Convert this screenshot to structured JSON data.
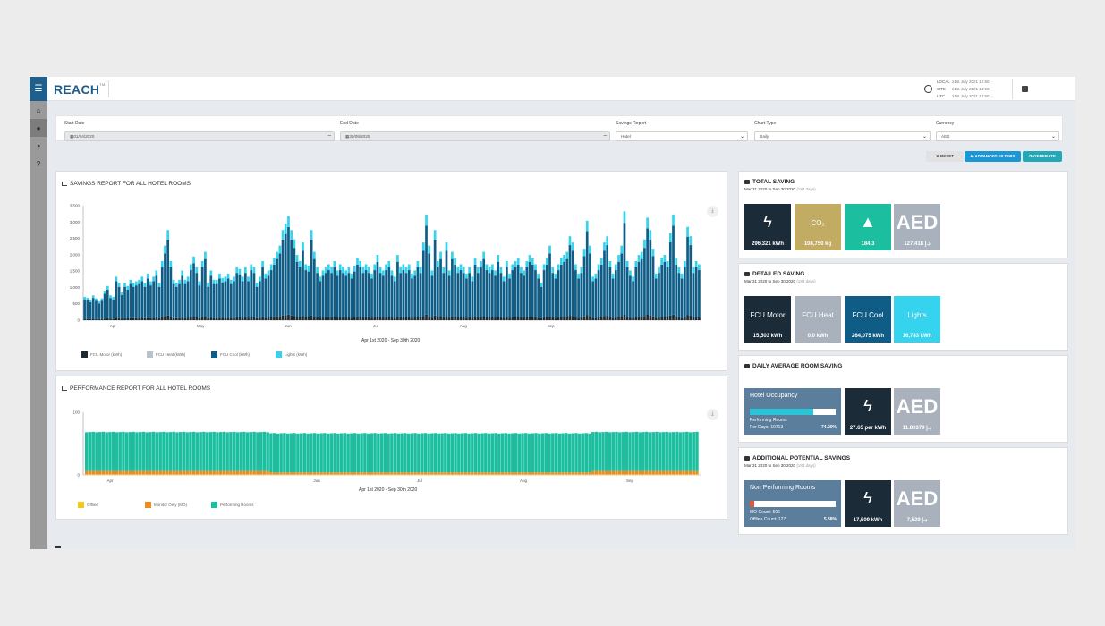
{
  "app": {
    "logo": "REACH",
    "logo_tm": "TM"
  },
  "header": {
    "times": [
      {
        "label": "LOCAL",
        "value": "21st July 2021 12:50"
      },
      {
        "label": "SITE",
        "value": "21st July 2021 14:50"
      },
      {
        "label": "UTC",
        "value": "21st July 2021 10:50"
      }
    ]
  },
  "filters": {
    "start_date": {
      "label": "Start Date",
      "value": "01/04/2020"
    },
    "end_date": {
      "label": "End Date",
      "value": "30/09/2020"
    },
    "savings_report": {
      "label": "Savings Report",
      "value": "Hotel"
    },
    "chart_type": {
      "label": "Chart Type",
      "value": "Daily"
    },
    "currency": {
      "label": "Currency",
      "value": "AED"
    }
  },
  "buttons": {
    "reset": "✕ RESET",
    "advanced": "⇋ ADVANCED FILTERS",
    "generate": "⟳ GENERATE"
  },
  "savings_panel": {
    "title": "SAVINGS REPORT FOR ALL HOTEL ROOMS",
    "caption": "Apr 1st 2020 - Sep 30th 2020",
    "legend": [
      {
        "label": "FCU Motor (kWh)",
        "color": "#1b2a33"
      },
      {
        "label": "FCU Heat (kWh)",
        "color": "#b7c2cc"
      },
      {
        "label": "FCU Cool (kWh)",
        "color": "#0f5d86"
      },
      {
        "label": "Lights (kWh)",
        "color": "#36d3ef"
      }
    ]
  },
  "performance_panel": {
    "title": "PERFORMANCE REPORT FOR ALL HOTEL ROOMS",
    "caption": "Apr 1st 2020 - Sep 30th 2020",
    "legend": [
      {
        "label": "Offline",
        "color": "#f5c518"
      },
      {
        "label": "Monitor Only (MO)",
        "color": "#f08a1c"
      },
      {
        "label": "Performing Rooms",
        "color": "#1bbf9f"
      }
    ]
  },
  "total_saving": {
    "title": "TOTAL SAVING",
    "range": "Mar 31 2020 to Sep 30 2020",
    "days": "(183 days)",
    "tiles": [
      {
        "value": "296,321 kWh",
        "color": "#1b2b38"
      },
      {
        "value": "108,750 kg",
        "badge": "CO₂",
        "color": "#c2ab62"
      },
      {
        "value": "184.3",
        "color": "#1bbf9f"
      },
      {
        "big": "AED",
        "value": "127,418 د.إ",
        "color": "#a9b2bc"
      }
    ]
  },
  "detailed_saving": {
    "title": "DETAILED SAVING",
    "range": "Mar 31 2020 to Sep 30 2020",
    "days": "(183 days)",
    "tiles": [
      {
        "name": "FCU Motor",
        "value": "15,503 kWh",
        "color": "#1b2b38"
      },
      {
        "name": "FCU Heat",
        "value": "0.0 kWh",
        "color": "#a9b2bc"
      },
      {
        "name": "FCU Cool",
        "value": "264,075 kWh",
        "color": "#0f5d86"
      },
      {
        "name": "Lights",
        "value": "16,743 kWh",
        "color": "#36d3ef"
      }
    ]
  },
  "daily_average": {
    "title": "DAILY AVERAGE ROOM SAVING",
    "occupancy": {
      "title": "Hotel Occupancy",
      "l1": "Performing Rooms",
      "l2": "Per Days: 10713",
      "pct": "74.20%",
      "fill": 0.742
    },
    "energy": "27.65 per kWh",
    "currency": {
      "big": "AED",
      "value": "11.89379 د.إ"
    }
  },
  "additional": {
    "title": "ADDITIONAL POTENTIAL SAVINGS",
    "range": "Mar 31 2020 to Sep 30 2020",
    "days": "(183 days)",
    "non_perf": {
      "title": "Non Performing Rooms",
      "l1": "MO Count: 506",
      "l2": "Offline Count: 127",
      "pct": "5.58%",
      "fill": 0.0558
    },
    "energy": "17,509 kWh",
    "currency": {
      "big": "AED",
      "value": "7,529 د.إ"
    }
  },
  "chart_data": [
    {
      "type": "bar",
      "stacked": true,
      "title": "SAVINGS REPORT FOR ALL HOTEL ROOMS",
      "xlabel": "Apr 1st 2020 - Sep 30th 2020",
      "x_tick_labels": [
        "Apr",
        "May",
        "Jun",
        "Jul",
        "Aug",
        "Sep"
      ],
      "y_tick_labels": [
        "0",
        "500",
        "1,000",
        "1,500",
        "2,000",
        "2,500",
        "3,000",
        "3,500"
      ],
      "ylim": [
        0,
        3500
      ],
      "series_names": [
        "FCU Motor (kWh)",
        "FCU Heat (kWh)",
        "FCU Cool (kWh)",
        "Lights (kWh)"
      ],
      "totals": [
        750,
        720,
        650,
        800,
        700,
        600,
        700,
        950,
        1100,
        800,
        750,
        1400,
        1200,
        900,
        1200,
        1100,
        1300,
        1200,
        1250,
        1300,
        1400,
        1200,
        1500,
        1250,
        1400,
        1600,
        1200,
        1900,
        2400,
        2900,
        1900,
        1300,
        1200,
        1300,
        1600,
        1300,
        1400,
        1800,
        2050,
        1700,
        1250,
        1900,
        2200,
        1200,
        1600,
        1300,
        1300,
        1500,
        1350,
        1400,
        1500,
        1300,
        1400,
        1700,
        1650,
        1400,
        1700,
        1400,
        1800,
        1700,
        1200,
        1400,
        1900,
        1500,
        1600,
        1800,
        2000,
        2200,
        2400,
        2900,
        3100,
        3350,
        2900,
        2600,
        2100,
        1900,
        2500,
        1800,
        1750,
        2900,
        2200,
        1700,
        1400,
        1600,
        1700,
        1800,
        1700,
        1900,
        1600,
        1800,
        1700,
        1600,
        1700,
        1500,
        1750,
        2000,
        1900,
        1700,
        1800,
        1700,
        1500,
        1800,
        2100,
        1700,
        1600,
        1800,
        1900,
        1600,
        1400,
        2100,
        1700,
        1800,
        1700,
        1800,
        1500,
        1600,
        1900,
        1700,
        2500,
        3400,
        2400,
        1600,
        2900,
        1900,
        2200,
        1700,
        2500,
        1600,
        2200,
        2000,
        1700,
        1800,
        1700,
        1500,
        1700,
        1400,
        2000,
        1700,
        1900,
        2200,
        1800,
        1700,
        1800,
        1600,
        2100,
        1700,
        1400,
        1900,
        1500,
        1800,
        1900,
        2000,
        1700,
        1600,
        1900,
        2100,
        2000,
        1800,
        1500,
        1200,
        1800,
        2000,
        2400,
        1700,
        1500,
        1800,
        2000,
        2100,
        2200,
        2700,
        2500,
        1800,
        1500,
        1700,
        2300,
        3200,
        2400,
        1400,
        1500,
        1800,
        2000,
        2500,
        2700,
        1900,
        1500,
        1800,
        2100,
        2400,
        3500,
        1900,
        1600,
        1400,
        1900,
        2100,
        2200,
        2600,
        3300,
        2900,
        2300,
        1500,
        1700,
        2000,
        2100,
        1900,
        2800,
        3400,
        2000,
        1700,
        1500,
        1900,
        3000,
        2700,
        1700,
        1900,
        1800
      ],
      "cool_share": 0.8,
      "lights_share": 0.1,
      "motor_share": 0.05
    },
    {
      "type": "bar",
      "stacked": true,
      "title": "PERFORMANCE REPORT FOR ALL HOTEL ROOMS",
      "xlabel": "Apr 1st 2020 - Sep 30th 2020",
      "x_tick_labels": [
        "Apr",
        "Jun",
        "Jul",
        "Aug",
        "Sep"
      ],
      "y_tick_labels": [
        "0",
        "100"
      ],
      "ylim": [
        0,
        100
      ],
      "series_names": [
        "Offline",
        "Monitor Only (MO)",
        "Performing Rooms"
      ],
      "days": 183,
      "performing": 62,
      "monitor_only": 5,
      "offline": 1
    }
  ]
}
